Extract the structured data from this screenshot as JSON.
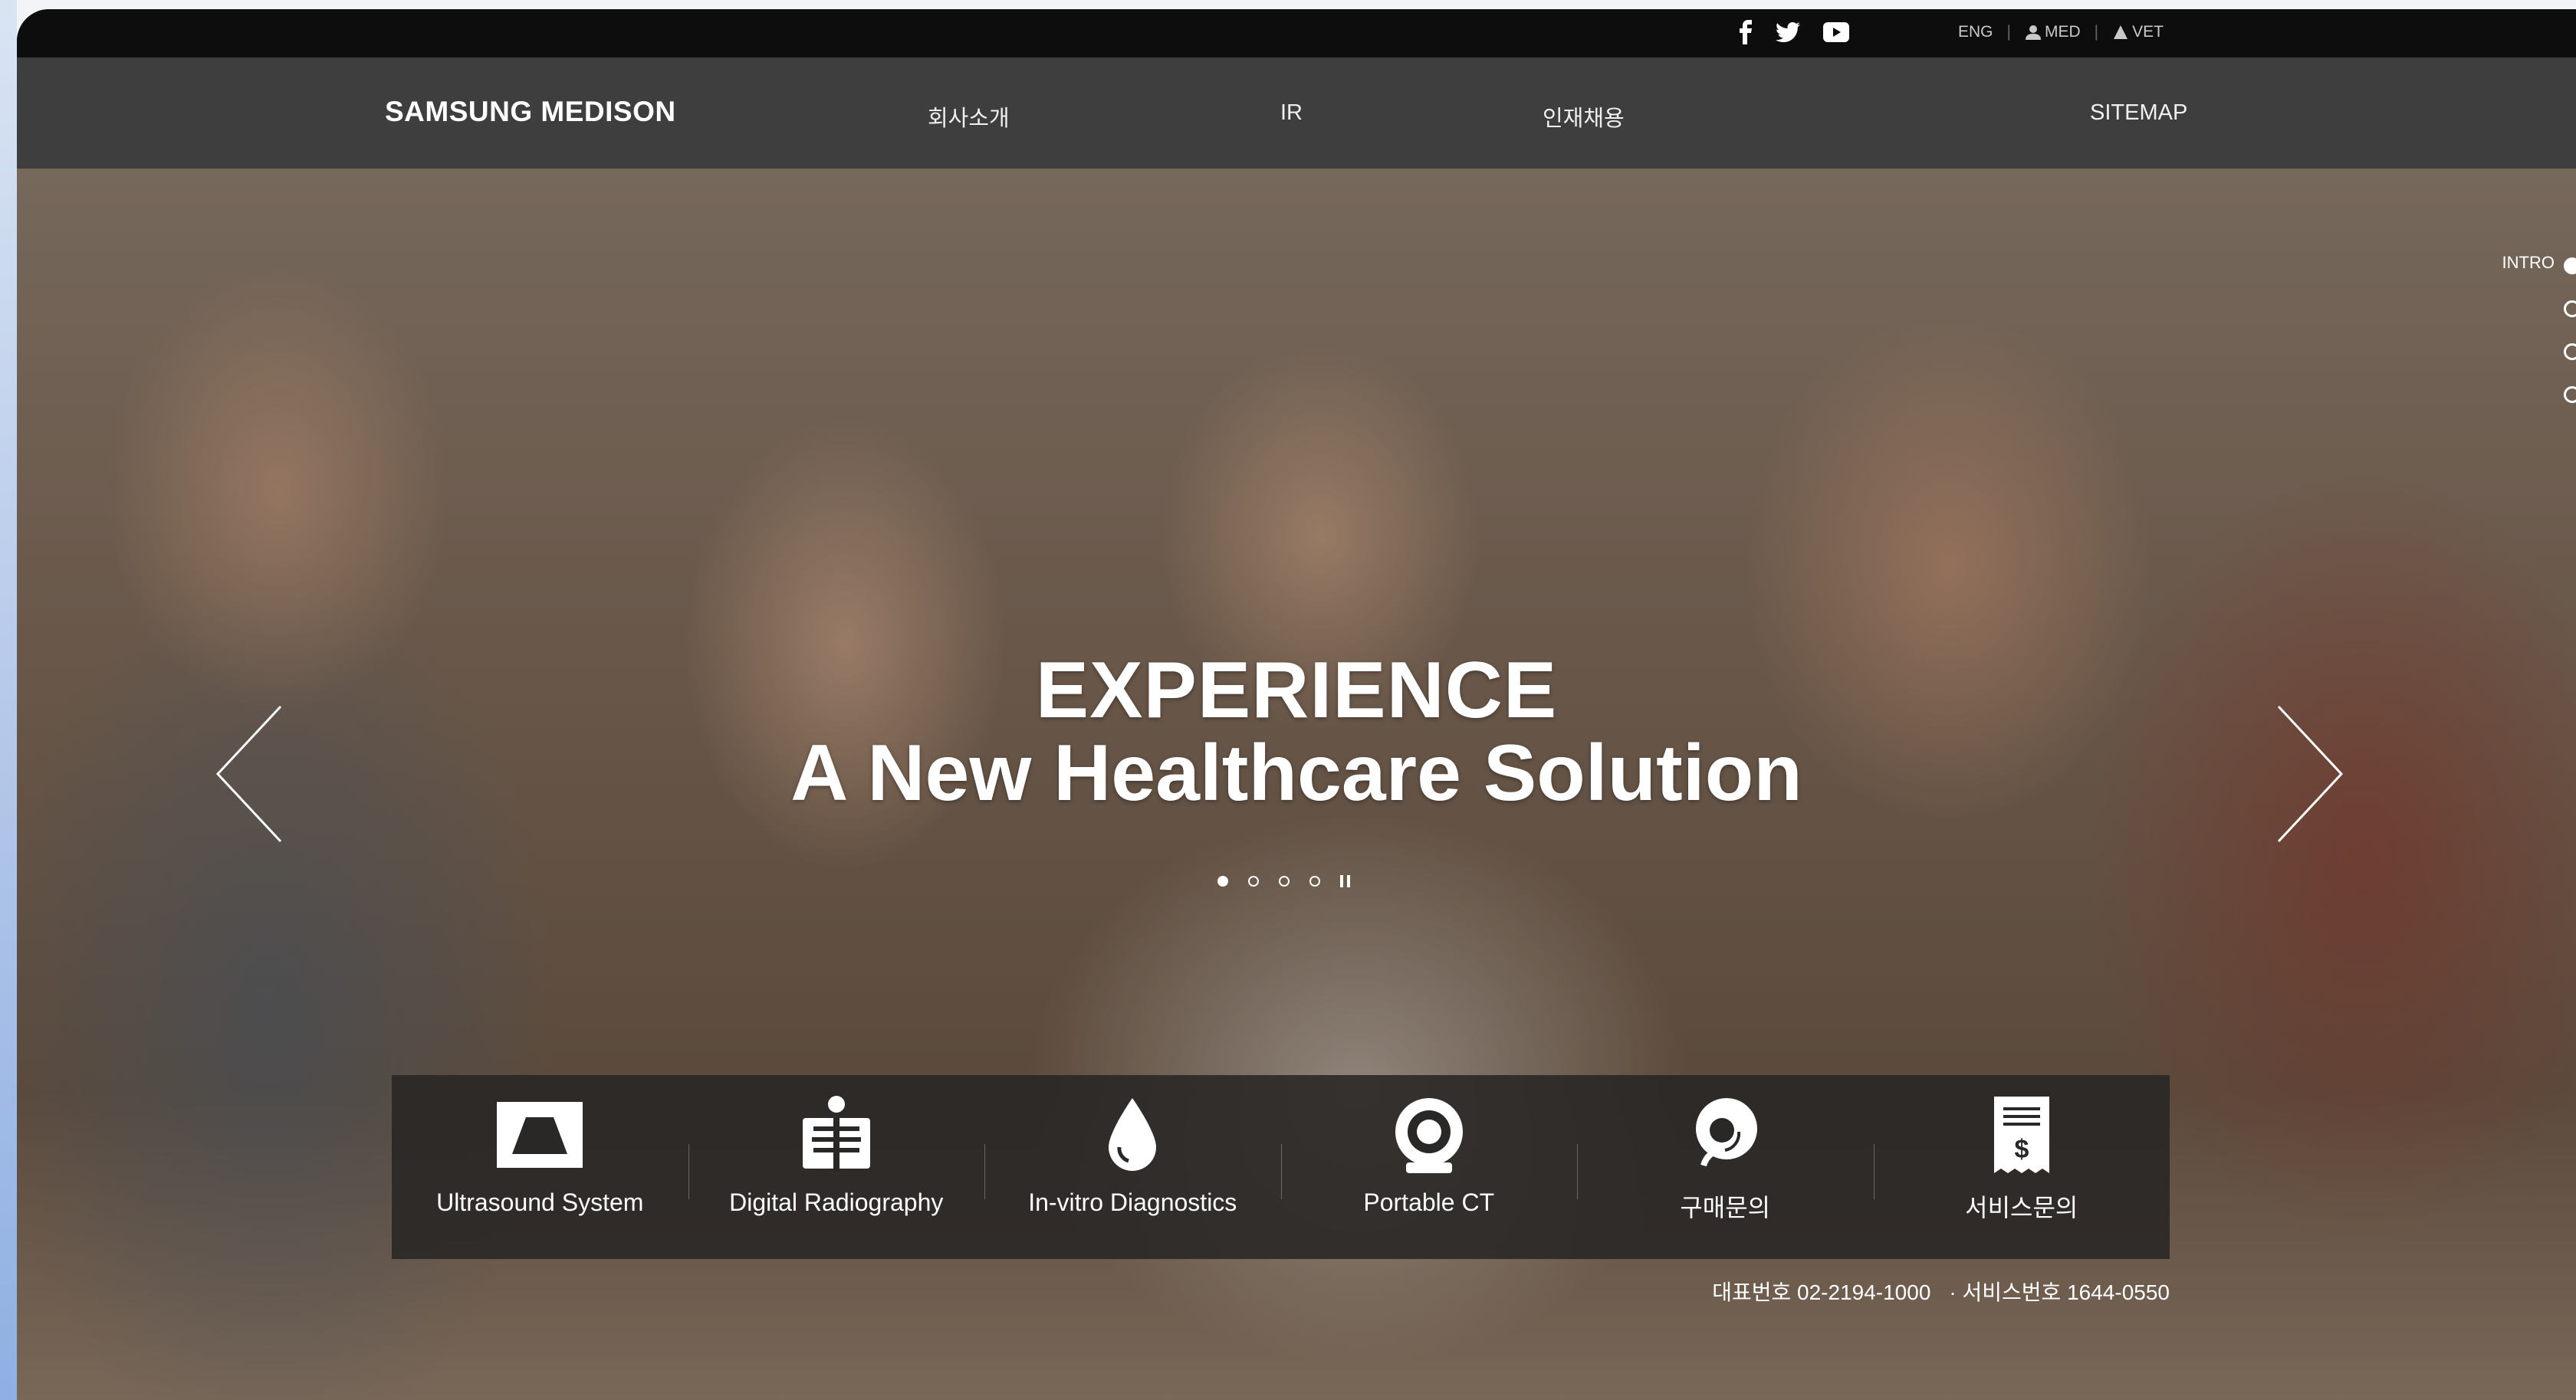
{
  "topbar": {
    "social": [
      "facebook-icon",
      "twitter-icon",
      "youtube-icon"
    ],
    "links": {
      "eng": "ENG",
      "med": "MED",
      "vet": "VET"
    }
  },
  "nav": {
    "logo": "SAMSUNG MEDISON",
    "items": [
      "회사소개",
      "IR",
      "인재채용"
    ],
    "sitemap": "SITEMAP"
  },
  "hero": {
    "title_line1": "EXPERIENCE",
    "title_line2": "A New Healthcare Solution",
    "slides": 4,
    "active_slide": 1
  },
  "side_indicator": {
    "label": "INTRO"
  },
  "products": [
    {
      "label": "Ultrasound System",
      "icon": "ultrasound-icon"
    },
    {
      "label": "Digital Radiography",
      "icon": "radiography-icon"
    },
    {
      "label": "In-vitro Diagnostics",
      "icon": "drop-icon"
    },
    {
      "label": "Portable CT",
      "icon": "ct-scanner-icon"
    },
    {
      "label": "구매문의",
      "icon": "consultant-icon"
    },
    {
      "label": "서비스문의",
      "icon": "receipt-icon"
    }
  ],
  "contact": {
    "main": "대표번호 02-2194-1000",
    "service": "· 서비스번호 1644-0550"
  },
  "colors": {
    "topbar": "#0d0d0d",
    "nav": "#3e3e3e",
    "product_bar": "#282624"
  }
}
